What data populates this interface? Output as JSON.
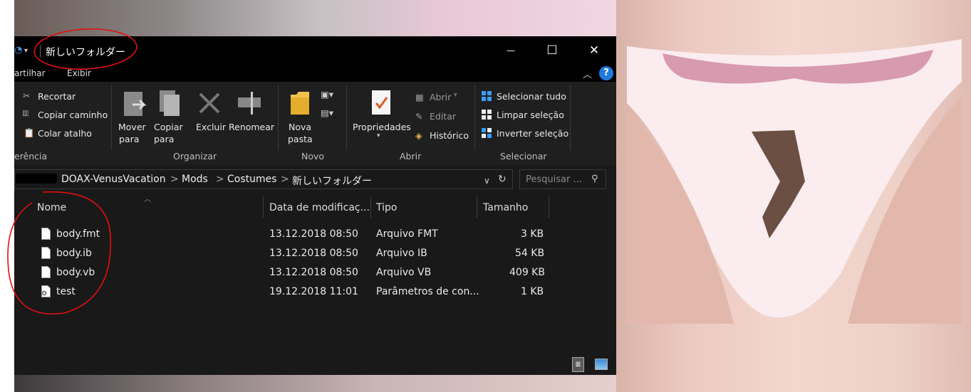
{
  "window": {
    "title": "新しいフォルダー",
    "controls": {
      "minimize": "—",
      "maximize": "☐",
      "close": "✕"
    }
  },
  "ribbon_tabs": [
    {
      "label": "artilhar"
    },
    {
      "label": "Exibir"
    }
  ],
  "ribbon": {
    "clipboard": {
      "recortar": "Recortar",
      "copiar_caminho": "Copiar caminho",
      "colar_atalho": "Colar atalho",
      "group_label": "erência"
    },
    "organizar": {
      "mover_para_1": "Mover",
      "mover_para_2": "para",
      "copiar_para_1": "Copiar",
      "copiar_para_2": "para",
      "excluir": "Excluir",
      "renomear": "Renomear",
      "group_label": "Organizar"
    },
    "novo": {
      "nova_pasta_1": "Nova",
      "nova_pasta_2": "pasta",
      "group_label": "Novo"
    },
    "abrir": {
      "propriedades": "Propriedades",
      "abrir": "Abrir",
      "editar": "Editar",
      "historico": "Histórico",
      "group_label": "Abrir"
    },
    "selecionar": {
      "selecionar_tudo": "Selecionar tudo",
      "limpar_selecao": "Limpar seleção",
      "inverter_selecao": "Inverter seleção",
      "group_label": "Selecionar"
    }
  },
  "address": {
    "crumbs": [
      "DOAX-VenusVacation",
      "Mods",
      "Costumes",
      "新しいフォルダー"
    ],
    "separator": ">"
  },
  "search": {
    "placeholder": "Pesquisar ..."
  },
  "columns": {
    "name": "Nome",
    "date": "Data de modificaç...",
    "type": "Tipo",
    "size": "Tamanho"
  },
  "files": [
    {
      "name": "body.fmt",
      "date": "13.12.2018 08:50",
      "type": "Arquivo FMT",
      "size": "3 KB",
      "icon": "file-icon"
    },
    {
      "name": "body.ib",
      "date": "13.12.2018 08:50",
      "type": "Arquivo IB",
      "size": "54 KB",
      "icon": "file-icon"
    },
    {
      "name": "body.vb",
      "date": "13.12.2018 08:50",
      "type": "Arquivo VB",
      "size": "409 KB",
      "icon": "file-icon"
    },
    {
      "name": "test",
      "date": "19.12.2018 11:01",
      "type": "Parâmetros de con...",
      "size": "1 KB",
      "icon": "settings-file-icon"
    }
  ],
  "colors": {
    "accent": "#3a9ef7",
    "annotation_red": "#e01010",
    "window_bg": "#191919"
  }
}
